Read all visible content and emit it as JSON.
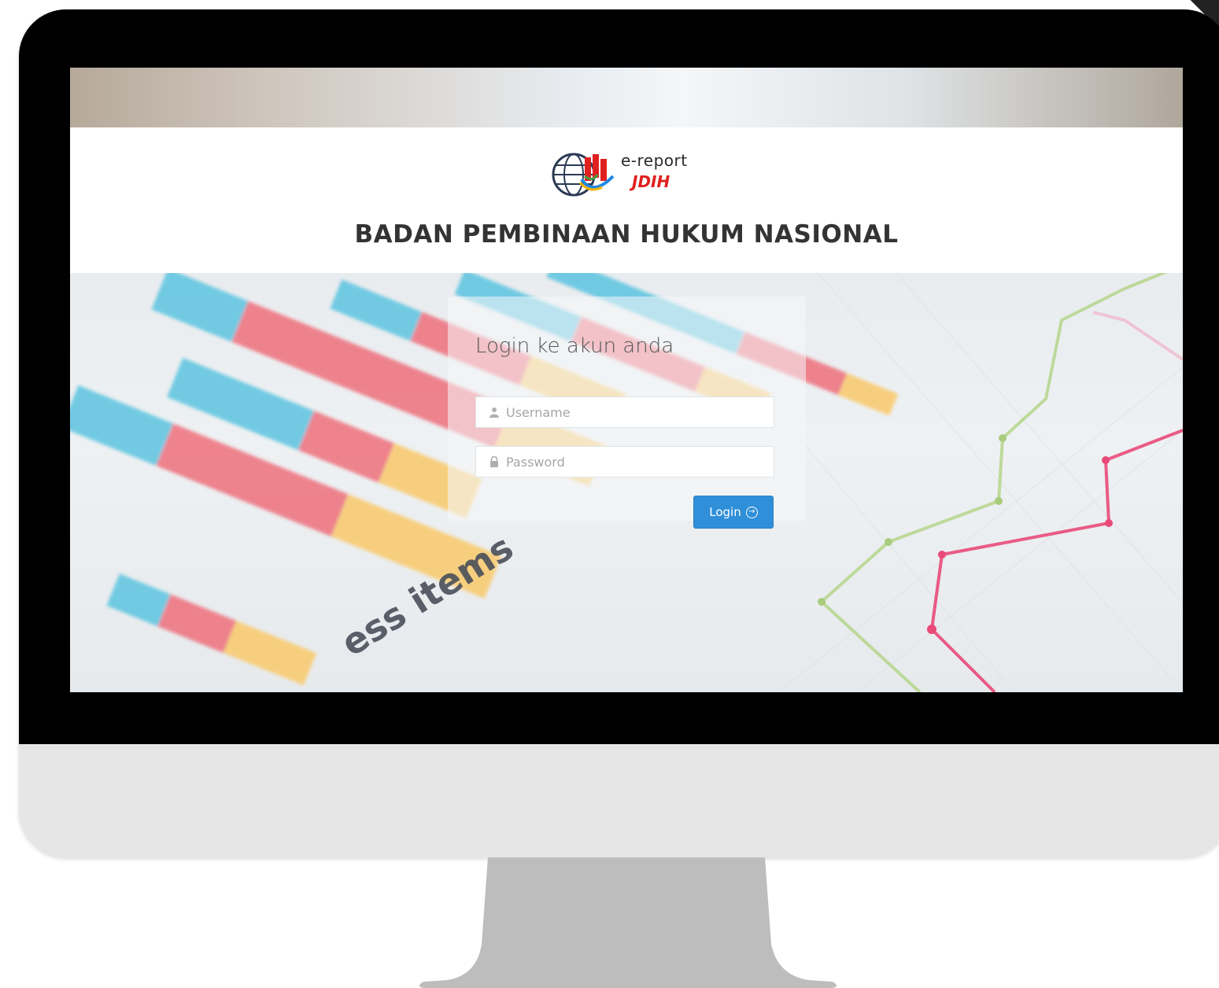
{
  "logo": {
    "text_top": "e-report",
    "text_bottom": "JDIH"
  },
  "header": {
    "org_title": "BADAN PEMBINAAN HUKUM NASIONAL"
  },
  "login": {
    "heading": "Login ke akun anda",
    "username_placeholder": "Username",
    "username_value": "",
    "password_placeholder": "Password",
    "password_value": "",
    "button_label": "Login",
    "button_icon": "arrow-circle-right-icon"
  },
  "background_photo": {
    "visible_text": "ess items"
  },
  "colors": {
    "button": "#2f8fd8",
    "logo_red": "#e02020",
    "title_text": "#333333",
    "bezel": "#000000",
    "monitor_body": "#e6e6e6",
    "stand": "#bdbdbd"
  }
}
